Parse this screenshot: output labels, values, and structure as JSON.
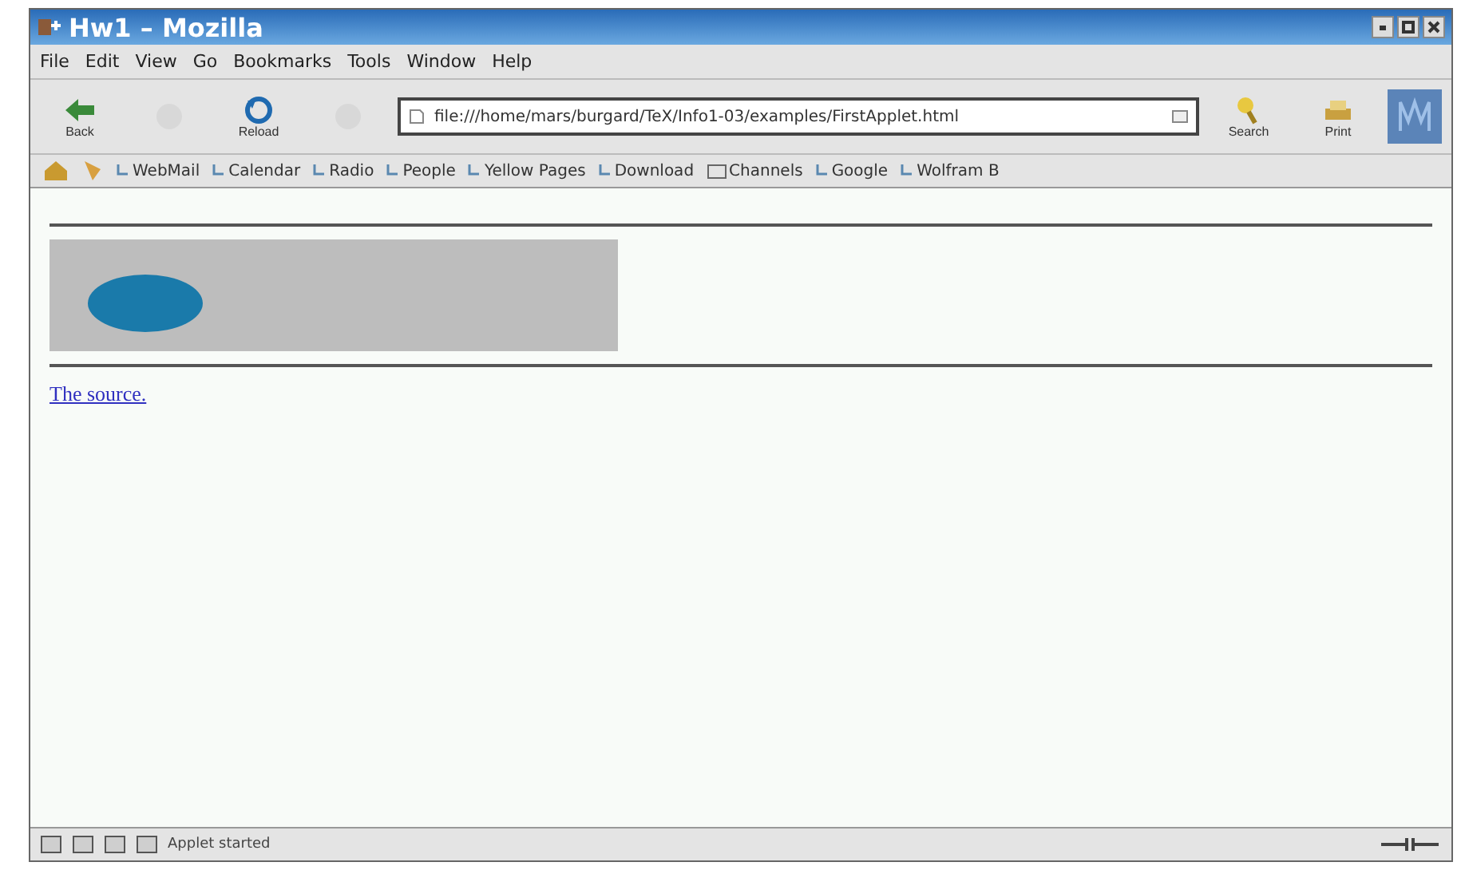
{
  "window": {
    "title": "Hw1 – Mozilla"
  },
  "menu": [
    "File",
    "Edit",
    "View",
    "Go",
    "Bookmarks",
    "Tools",
    "Window",
    "Help"
  ],
  "toolbar": {
    "left": [
      {
        "kind": "back",
        "label": "Back"
      },
      {
        "kind": "forward"
      },
      {
        "kind": "reload",
        "label": "Reload"
      },
      {
        "kind": "stop"
      }
    ],
    "url": "file:///home/mars/burgard/TeX/Info1-03/examples/FirstApplet.html",
    "right": [
      {
        "kind": "search",
        "label": "Search"
      },
      {
        "kind": "print",
        "label": "Print"
      }
    ]
  },
  "bookmarks": [
    {
      "kind": "link",
      "label": "WebMail"
    },
    {
      "kind": "link",
      "label": "Calendar"
    },
    {
      "kind": "link",
      "label": "Radio"
    },
    {
      "kind": "link",
      "label": "People"
    },
    {
      "kind": "link",
      "label": "Yellow Pages"
    },
    {
      "kind": "link",
      "label": "Download"
    },
    {
      "kind": "folder",
      "label": "Channels"
    },
    {
      "kind": "link",
      "label": "Google"
    },
    {
      "kind": "link",
      "label": "Wolfram B"
    }
  ],
  "content": {
    "link": "The source."
  },
  "status_bar": {
    "text": "Applet started"
  }
}
